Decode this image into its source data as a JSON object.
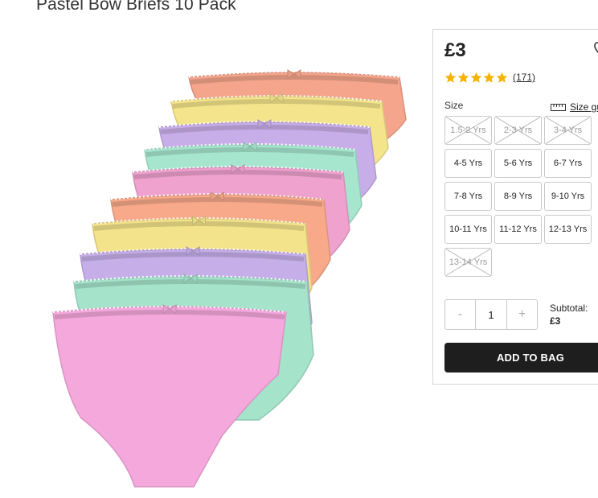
{
  "product": {
    "title": "Pastel Bow Briefs 10 Pack",
    "price": "£3",
    "rating": {
      "stars": 5,
      "review_count": "(171)"
    },
    "size_label": "Size",
    "size_guide_label": "Size gu",
    "sizes": [
      {
        "label": "1.5-2 Yrs",
        "available": false
      },
      {
        "label": "2-3 Yrs",
        "available": false
      },
      {
        "label": "3-4 Yrs",
        "available": false
      },
      {
        "label": "4-5 Yrs",
        "available": true
      },
      {
        "label": "5-6 Yrs",
        "available": true
      },
      {
        "label": "6-7 Yrs",
        "available": true
      },
      {
        "label": "7-8 Yrs",
        "available": true
      },
      {
        "label": "8-9 Yrs",
        "available": true
      },
      {
        "label": "9-10 Yrs",
        "available": true
      },
      {
        "label": "10-11 Yrs",
        "available": true
      },
      {
        "label": "11-12 Yrs",
        "available": true
      },
      {
        "label": "12-13 Yrs",
        "available": true
      },
      {
        "label": "13-14 Yrs",
        "available": false
      }
    ],
    "quantity": {
      "minus": "-",
      "value": "1",
      "plus": "+"
    },
    "subtotal_label": "Subtotal:",
    "subtotal_value": "£3",
    "add_to_bag_label": "ADD TO BAG",
    "colors": {
      "star": "#f5b301",
      "button": "#1e1e1e",
      "briefs": [
        "#f5a58c",
        "#f4e58c",
        "#c8aee8",
        "#a6e6cf",
        "#f0a2cf",
        "#f7a98a",
        "#f3e38a",
        "#c6aee9",
        "#a5e3cb",
        "#f5a8dc"
      ]
    },
    "icons": {
      "wishlist": "heart-icon",
      "star": "star-icon",
      "size_guide": "ruler-icon"
    }
  }
}
